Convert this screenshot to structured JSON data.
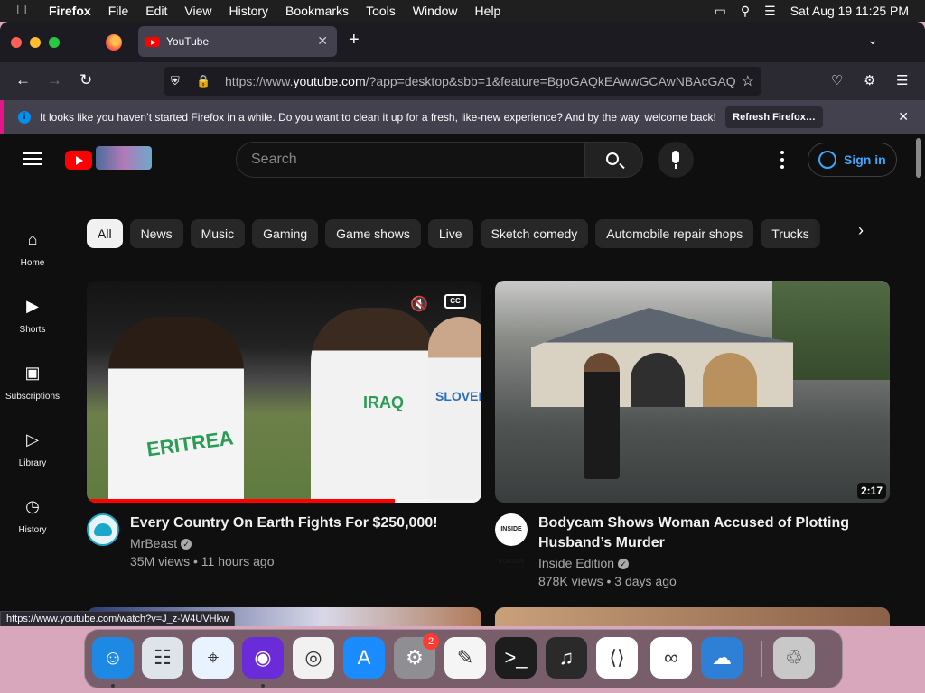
{
  "menubar": {
    "app_name": "Firefox",
    "items": [
      "File",
      "Edit",
      "View",
      "History",
      "Bookmarks",
      "Tools",
      "Window",
      "Help"
    ],
    "datetime": "Sat Aug 19  11:25 PM"
  },
  "browser": {
    "tab_title": "YouTube",
    "url_prefix": "https://www.",
    "url_host": "youtube.com",
    "url_rest": "/?app=desktop&sbb=1&feature=BgoGAQkEAwwGCAwNBAcGAQ",
    "notification_text": "It looks like you haven’t started Firefox in a while. Do you want to clean it up for a fresh, like-new experience? And by the way, welcome back!",
    "notification_button": "Refresh Firefox…",
    "status_url": "https://www.youtube.com/watch?v=J_z-W4UVHkw"
  },
  "youtube": {
    "search_placeholder": "Search",
    "signin_label": "Sign in",
    "chips": [
      "All",
      "News",
      "Music",
      "Gaming",
      "Game shows",
      "Live",
      "Sketch comedy",
      "Automobile repair shops",
      "Trucks"
    ],
    "active_chip": "All",
    "guide": [
      {
        "label": "Home",
        "icon": "home-icon",
        "glyph": "⌂"
      },
      {
        "label": "Shorts",
        "icon": "shorts-icon",
        "glyph": "▶"
      },
      {
        "label": "Subscriptions",
        "icon": "subscriptions-icon",
        "glyph": "▣"
      },
      {
        "label": "Library",
        "icon": "library-icon",
        "glyph": "▷"
      },
      {
        "label": "History",
        "icon": "history-icon",
        "glyph": "◷"
      }
    ],
    "videos": [
      {
        "title": "Every Country On Earth Fights For $250,000!",
        "channel": "MrBeast",
        "stats": "35M views • 11 hours ago",
        "thumb_labels": [
          "ERITREA",
          "IRAQ",
          "SLOVENIA"
        ],
        "cc_label": "CC",
        "watch_progress": 0.78
      },
      {
        "title": "Bodycam Shows Woman Accused of Plotting Husband’s Murder",
        "channel": "Inside Edition",
        "avatar_text": "INSIDE EDITION",
        "stats": "878K views • 3 days ago",
        "duration": "2:17"
      }
    ]
  },
  "dock": {
    "apps": [
      {
        "name": "finder",
        "color": "#1e88e5"
      },
      {
        "name": "launchpad",
        "color": "#dfe3ea"
      },
      {
        "name": "safari",
        "color": "#e9f2ff"
      },
      {
        "name": "firefox",
        "color": "#6a2bd9"
      },
      {
        "name": "chrome",
        "color": "#f1f1f1"
      },
      {
        "name": "app-store",
        "color": "#1a8cff"
      },
      {
        "name": "system-settings",
        "color": "#8e8e93",
        "badge": "2"
      },
      {
        "name": "textedit",
        "color": "#f5f5f5"
      },
      {
        "name": "terminal",
        "color": "#1d1d1d"
      },
      {
        "name": "garageband",
        "color": "#2a2a2a"
      },
      {
        "name": "vscode",
        "color": "#ffffff"
      },
      {
        "name": "visual-studio",
        "color": "#ffffff"
      },
      {
        "name": "weather",
        "color": "#2e7fd6"
      },
      {
        "name": "trash",
        "color": "#c8c8c8"
      }
    ]
  }
}
